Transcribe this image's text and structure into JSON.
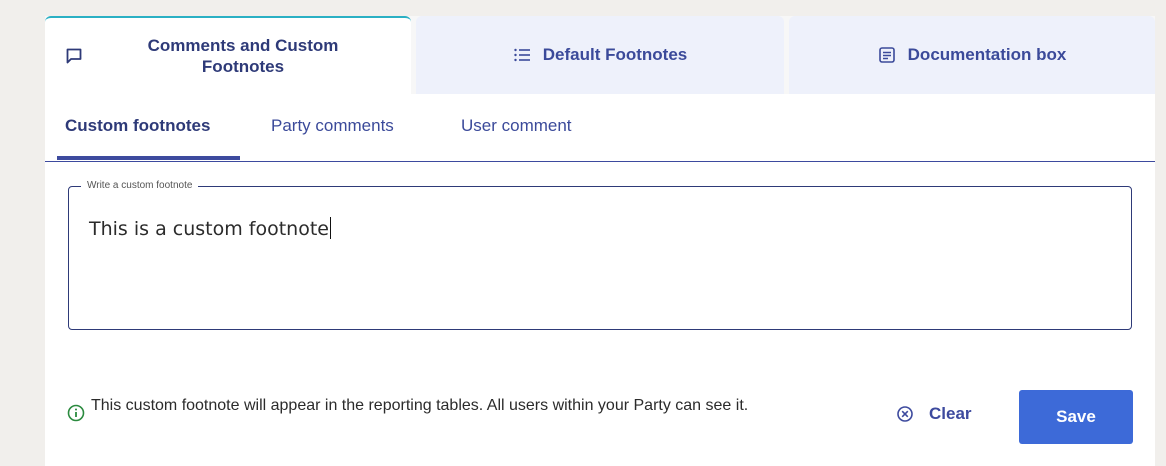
{
  "tabs": [
    {
      "label": "Comments and Custom Footnotes",
      "icon": "comment-icon",
      "active": true
    },
    {
      "label": "Default Footnotes",
      "icon": "list-icon",
      "active": false
    },
    {
      "label": "Documentation box",
      "icon": "document-icon",
      "active": false
    }
  ],
  "subtabs": [
    {
      "label": "Custom footnotes",
      "active": true
    },
    {
      "label": "Party comments",
      "active": false
    },
    {
      "label": "User comment",
      "active": false
    }
  ],
  "footnote_field": {
    "legend": "Write a custom footnote",
    "value": "This is a custom footnote"
  },
  "footer": {
    "info_icon": "info-icon",
    "info_text": "This custom footnote will appear in the reporting tables. All users within your Party can see it.",
    "clear_icon": "clear-circle-icon",
    "clear_label": "Clear",
    "save_label": "Save"
  },
  "colors": {
    "primary": "#3d4a9e",
    "save_button": "#3d6ad8",
    "active_tab_accent": "#2bb0c4",
    "inactive_tab_bg": "#eef1fb"
  }
}
